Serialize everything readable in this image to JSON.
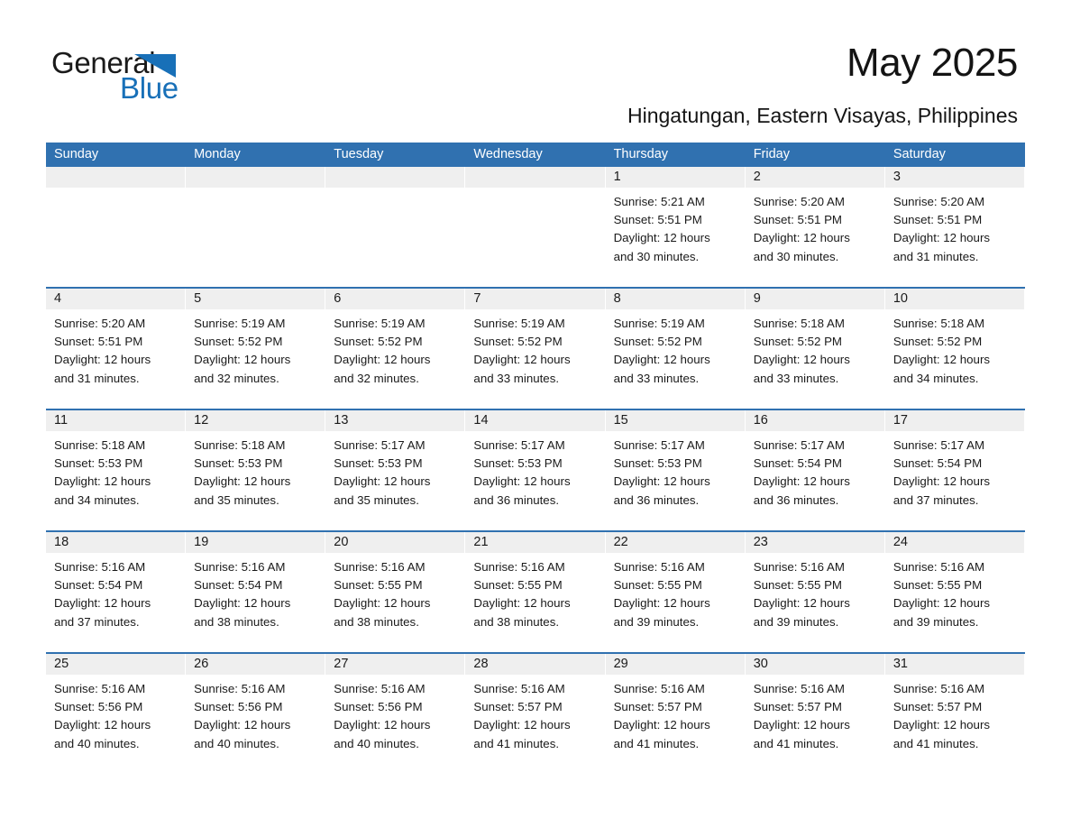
{
  "brand": {
    "name_part1": "General",
    "name_part2": "Blue",
    "triangle_icon": "triangle-icon",
    "colors": {
      "blue": "#1870b8",
      "header_blue": "#3071b0",
      "strip_gray": "#efefef"
    }
  },
  "header": {
    "title": "May 2025",
    "subtitle": "Hingatungan, Eastern Visayas, Philippines"
  },
  "calendar": {
    "weekdays": [
      "Sunday",
      "Monday",
      "Tuesday",
      "Wednesday",
      "Thursday",
      "Friday",
      "Saturday"
    ],
    "weeks": [
      [
        {
          "day": "",
          "lines": []
        },
        {
          "day": "",
          "lines": []
        },
        {
          "day": "",
          "lines": []
        },
        {
          "day": "",
          "lines": []
        },
        {
          "day": "1",
          "lines": [
            "Sunrise: 5:21 AM",
            "Sunset: 5:51 PM",
            "Daylight: 12 hours",
            "and 30 minutes."
          ]
        },
        {
          "day": "2",
          "lines": [
            "Sunrise: 5:20 AM",
            "Sunset: 5:51 PM",
            "Daylight: 12 hours",
            "and 30 minutes."
          ]
        },
        {
          "day": "3",
          "lines": [
            "Sunrise: 5:20 AM",
            "Sunset: 5:51 PM",
            "Daylight: 12 hours",
            "and 31 minutes."
          ]
        }
      ],
      [
        {
          "day": "4",
          "lines": [
            "Sunrise: 5:20 AM",
            "Sunset: 5:51 PM",
            "Daylight: 12 hours",
            "and 31 minutes."
          ]
        },
        {
          "day": "5",
          "lines": [
            "Sunrise: 5:19 AM",
            "Sunset: 5:52 PM",
            "Daylight: 12 hours",
            "and 32 minutes."
          ]
        },
        {
          "day": "6",
          "lines": [
            "Sunrise: 5:19 AM",
            "Sunset: 5:52 PM",
            "Daylight: 12 hours",
            "and 32 minutes."
          ]
        },
        {
          "day": "7",
          "lines": [
            "Sunrise: 5:19 AM",
            "Sunset: 5:52 PM",
            "Daylight: 12 hours",
            "and 33 minutes."
          ]
        },
        {
          "day": "8",
          "lines": [
            "Sunrise: 5:19 AM",
            "Sunset: 5:52 PM",
            "Daylight: 12 hours",
            "and 33 minutes."
          ]
        },
        {
          "day": "9",
          "lines": [
            "Sunrise: 5:18 AM",
            "Sunset: 5:52 PM",
            "Daylight: 12 hours",
            "and 33 minutes."
          ]
        },
        {
          "day": "10",
          "lines": [
            "Sunrise: 5:18 AM",
            "Sunset: 5:52 PM",
            "Daylight: 12 hours",
            "and 34 minutes."
          ]
        }
      ],
      [
        {
          "day": "11",
          "lines": [
            "Sunrise: 5:18 AM",
            "Sunset: 5:53 PM",
            "Daylight: 12 hours",
            "and 34 minutes."
          ]
        },
        {
          "day": "12",
          "lines": [
            "Sunrise: 5:18 AM",
            "Sunset: 5:53 PM",
            "Daylight: 12 hours",
            "and 35 minutes."
          ]
        },
        {
          "day": "13",
          "lines": [
            "Sunrise: 5:17 AM",
            "Sunset: 5:53 PM",
            "Daylight: 12 hours",
            "and 35 minutes."
          ]
        },
        {
          "day": "14",
          "lines": [
            "Sunrise: 5:17 AM",
            "Sunset: 5:53 PM",
            "Daylight: 12 hours",
            "and 36 minutes."
          ]
        },
        {
          "day": "15",
          "lines": [
            "Sunrise: 5:17 AM",
            "Sunset: 5:53 PM",
            "Daylight: 12 hours",
            "and 36 minutes."
          ]
        },
        {
          "day": "16",
          "lines": [
            "Sunrise: 5:17 AM",
            "Sunset: 5:54 PM",
            "Daylight: 12 hours",
            "and 36 minutes."
          ]
        },
        {
          "day": "17",
          "lines": [
            "Sunrise: 5:17 AM",
            "Sunset: 5:54 PM",
            "Daylight: 12 hours",
            "and 37 minutes."
          ]
        }
      ],
      [
        {
          "day": "18",
          "lines": [
            "Sunrise: 5:16 AM",
            "Sunset: 5:54 PM",
            "Daylight: 12 hours",
            "and 37 minutes."
          ]
        },
        {
          "day": "19",
          "lines": [
            "Sunrise: 5:16 AM",
            "Sunset: 5:54 PM",
            "Daylight: 12 hours",
            "and 38 minutes."
          ]
        },
        {
          "day": "20",
          "lines": [
            "Sunrise: 5:16 AM",
            "Sunset: 5:55 PM",
            "Daylight: 12 hours",
            "and 38 minutes."
          ]
        },
        {
          "day": "21",
          "lines": [
            "Sunrise: 5:16 AM",
            "Sunset: 5:55 PM",
            "Daylight: 12 hours",
            "and 38 minutes."
          ]
        },
        {
          "day": "22",
          "lines": [
            "Sunrise: 5:16 AM",
            "Sunset: 5:55 PM",
            "Daylight: 12 hours",
            "and 39 minutes."
          ]
        },
        {
          "day": "23",
          "lines": [
            "Sunrise: 5:16 AM",
            "Sunset: 5:55 PM",
            "Daylight: 12 hours",
            "and 39 minutes."
          ]
        },
        {
          "day": "24",
          "lines": [
            "Sunrise: 5:16 AM",
            "Sunset: 5:55 PM",
            "Daylight: 12 hours",
            "and 39 minutes."
          ]
        }
      ],
      [
        {
          "day": "25",
          "lines": [
            "Sunrise: 5:16 AM",
            "Sunset: 5:56 PM",
            "Daylight: 12 hours",
            "and 40 minutes."
          ]
        },
        {
          "day": "26",
          "lines": [
            "Sunrise: 5:16 AM",
            "Sunset: 5:56 PM",
            "Daylight: 12 hours",
            "and 40 minutes."
          ]
        },
        {
          "day": "27",
          "lines": [
            "Sunrise: 5:16 AM",
            "Sunset: 5:56 PM",
            "Daylight: 12 hours",
            "and 40 minutes."
          ]
        },
        {
          "day": "28",
          "lines": [
            "Sunrise: 5:16 AM",
            "Sunset: 5:57 PM",
            "Daylight: 12 hours",
            "and 41 minutes."
          ]
        },
        {
          "day": "29",
          "lines": [
            "Sunrise: 5:16 AM",
            "Sunset: 5:57 PM",
            "Daylight: 12 hours",
            "and 41 minutes."
          ]
        },
        {
          "day": "30",
          "lines": [
            "Sunrise: 5:16 AM",
            "Sunset: 5:57 PM",
            "Daylight: 12 hours",
            "and 41 minutes."
          ]
        },
        {
          "day": "31",
          "lines": [
            "Sunrise: 5:16 AM",
            "Sunset: 5:57 PM",
            "Daylight: 12 hours",
            "and 41 minutes."
          ]
        }
      ]
    ]
  }
}
